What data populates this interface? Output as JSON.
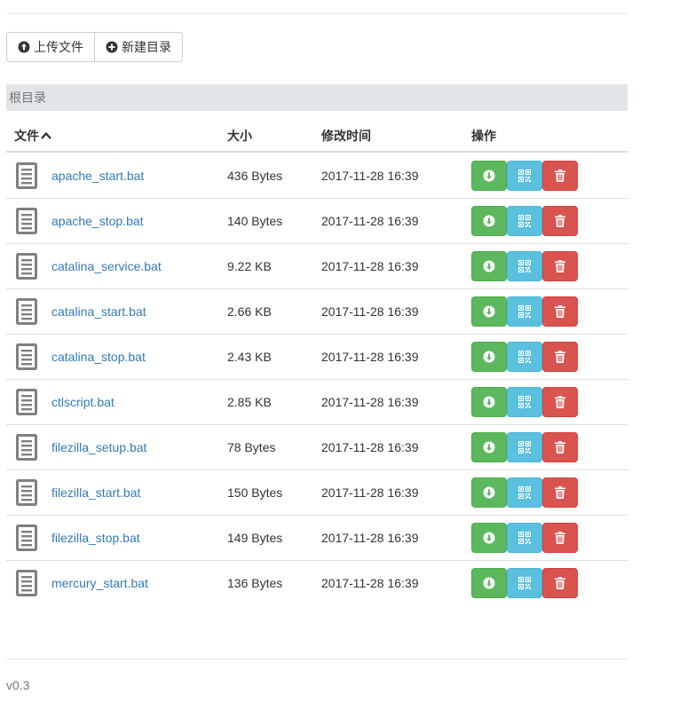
{
  "toolbar": {
    "upload_label": "上传文件",
    "new_dir_label": "新建目录"
  },
  "breadcrumb": {
    "root_label": "根目录"
  },
  "table": {
    "columns": {
      "file": "文件",
      "size": "大小",
      "modified": "修改时间",
      "actions": "操作"
    },
    "sort": "ascending",
    "rows": [
      {
        "name": "apache_start.bat",
        "size": "436 Bytes",
        "modified": "2017-11-28 16:39"
      },
      {
        "name": "apache_stop.bat",
        "size": "140 Bytes",
        "modified": "2017-11-28 16:39"
      },
      {
        "name": "catalina_service.bat",
        "size": "9.22 KB",
        "modified": "2017-11-28 16:39"
      },
      {
        "name": "catalina_start.bat",
        "size": "2.66 KB",
        "modified": "2017-11-28 16:39"
      },
      {
        "name": "catalina_stop.bat",
        "size": "2.43 KB",
        "modified": "2017-11-28 16:39"
      },
      {
        "name": "ctlscript.bat",
        "size": "2.85 KB",
        "modified": "2017-11-28 16:39"
      },
      {
        "name": "filezilla_setup.bat",
        "size": "78 Bytes",
        "modified": "2017-11-28 16:39"
      },
      {
        "name": "filezilla_start.bat",
        "size": "150 Bytes",
        "modified": "2017-11-28 16:39"
      },
      {
        "name": "filezilla_stop.bat",
        "size": "149 Bytes",
        "modified": "2017-11-28 16:39"
      },
      {
        "name": "mercury_start.bat",
        "size": "136 Bytes",
        "modified": "2017-11-28 16:39"
      }
    ]
  },
  "footer": {
    "version": "v0.3"
  },
  "icons": {
    "upload": "circle-arrow-up-icon",
    "new_dir": "plus-circle-icon",
    "sort": "chevron-up-icon",
    "file": "file-text-icon",
    "download": "circle-arrow-down-icon",
    "qrcode": "qrcode-icon",
    "delete": "trash-icon"
  },
  "colors": {
    "link": "#337ab7",
    "success": "#5cb85c",
    "info": "#5bc0de",
    "danger": "#d9534f",
    "breadcrumb_bg": "#e2e5e8"
  }
}
